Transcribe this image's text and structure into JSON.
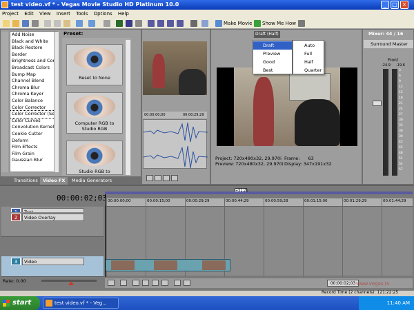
{
  "window": {
    "title": "test video.vf * - Vegas Movie Studio HD Platinum 10.0",
    "min": "_",
    "max": "□",
    "close": "×"
  },
  "menu": [
    "Project",
    "Edit",
    "View",
    "Insert",
    "Tools",
    "Options",
    "Help"
  ],
  "toolbar": {
    "make_movie": "Make Movie",
    "show_me_how": "Show Me How"
  },
  "fx_list": {
    "items": [
      "Add Noise",
      "Black and White",
      "Black Restore",
      "Border",
      "Brightness and Contrast",
      "Broadcast Colors",
      "Bump Map",
      "Channel Blend",
      "Chroma Blur",
      "Chroma Keyer",
      "Color Balance",
      "Color Corrector",
      "Color Corrector (Secondary)",
      "Color Curves",
      "Convolution Kernel",
      "Cookie Cutter",
      "Deform",
      "Film Effects",
      "Film Grain",
      "Gaussian Blur"
    ],
    "selected": "Color Corrector (Secondary)"
  },
  "preset": {
    "label": "Preset:",
    "items": [
      "Reset to None",
      "Computer RGB to Studio RGB",
      "Studio RGB to"
    ]
  },
  "tabs": [
    "Transitions",
    "Video FX",
    "Media Generators"
  ],
  "trimmer": {
    "start": "00:00:00;00",
    "end": "00:00:29;29"
  },
  "preview": {
    "quality": "Draft (Half)",
    "menu": [
      "Draft",
      "Preview",
      "Good",
      "Best"
    ],
    "submenu": [
      "Auto",
      "Full",
      "Half",
      "Quarter"
    ],
    "project_label": "Project:",
    "project_val": "720x480x32, 29.970i",
    "preview_label": "Preview:",
    "preview_val": "720x480x32, 29.970i",
    "frame_label": "Frame:",
    "frame_val": "63",
    "display_label": "Display:",
    "display_val": "347x191x32"
  },
  "mixer": {
    "title": "Mixer: 44 / 16",
    "master": "Surround Master",
    "front": "Front",
    "db_left": "-24.9",
    "db_right": "-19.6",
    "scale": [
      "3",
      "6",
      "9",
      "12",
      "15",
      "18",
      "21",
      "24",
      "27",
      "30",
      "33",
      "36",
      "39",
      "42",
      "45",
      "48",
      "51",
      "54",
      "57"
    ]
  },
  "timeline": {
    "timecode": "00:00:02;03",
    "marker": "+51;21",
    "ruler": [
      "00:00:00;00",
      "00:00:15;00",
      "00:00:29;29",
      "00:00:44;29",
      "00:00:59;28",
      "00:01:15;00",
      "00:01:29;29",
      "00:01:44;29"
    ],
    "tracks": [
      {
        "num": "1",
        "name": "Text",
        "color": "#3a5aa8"
      },
      {
        "num": "2",
        "name": "Video Overlay",
        "color": "#a83a3a"
      },
      {
        "num": "3",
        "name": "Video",
        "color": "#2f7ea0"
      }
    ],
    "rate_label": "Rate: 0.00",
    "position": "00:00:02;03",
    "record_time": "Record Time (2 channels): 121:22:25"
  },
  "watermark": "www.vegas.tv",
  "taskbar": {
    "start": "start",
    "task": "test video.vf * - Veg...",
    "clock": "11:40 AM"
  }
}
